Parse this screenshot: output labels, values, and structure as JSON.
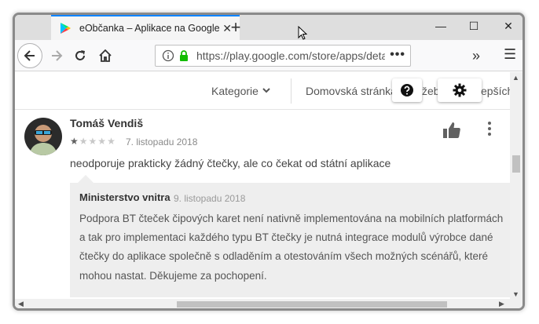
{
  "browser": {
    "tab_title": "eObčanka – Aplikace na Google Play",
    "tab_close": "✕",
    "new_tab": "+",
    "minimize": "—",
    "maximize": "☐",
    "close": "✕",
    "url": "https://play.google.com/store/apps/details?id=cz.eop",
    "url_more": "•••",
    "overflow": "»",
    "menu": "☰"
  },
  "page": {
    "nav": {
      "kategorie": "Kategorie",
      "home": "Domovská stránka",
      "partial_mid": "žeb",
      "partial_right": "epších"
    },
    "review": {
      "author": "Tomáš Vendiš",
      "rating": 1,
      "max_rating": 5,
      "date": "7. listopadu 2018",
      "text": "neodporuje prakticky žádný čtečky, ale co čekat od státní aplikace"
    },
    "reply": {
      "author": "Ministerstvo vnitra",
      "date": "9. listopadu 2018",
      "text": "Podpora BT čteček čipových karet není nativně implementována na mobilních platformách a tak pro implementaci každého typu BT čtečky je nutná integrace modulů výrobce dané čtečky do aplikace společně s odladěním a otestováním všech možných scénářů, které mohou nastat. Děkujeme za pochopení."
    }
  },
  "colors": {
    "tab_accent": "#0a84ff",
    "lock_green": "#12bc00",
    "reply_bg": "#eeeeee"
  }
}
